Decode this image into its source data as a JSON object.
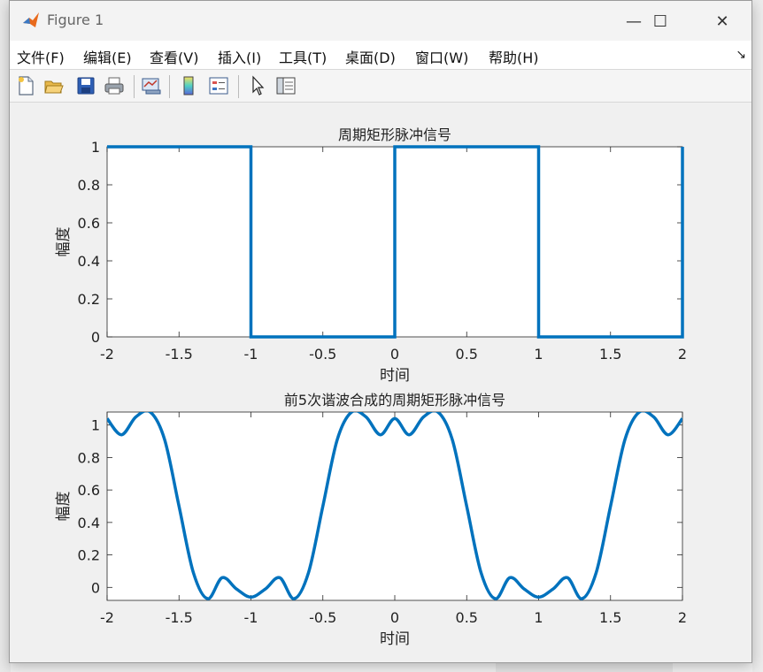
{
  "window": {
    "title": "Figure 1",
    "minimize_label": "—",
    "maximize_label": "☐",
    "close_label": "✕"
  },
  "menu": {
    "items": [
      "文件(F)",
      "编辑(E)",
      "查看(V)",
      "插入(I)",
      "工具(T)",
      "桌面(D)",
      "窗口(W)",
      "帮助(H)"
    ],
    "dock_label": "↘"
  },
  "toolbar": {
    "icons": [
      "new-figure-icon",
      "open-file-icon",
      "save-icon",
      "print-icon",
      "link-plot-icon",
      "colorbar-icon",
      "legend-icon",
      "pointer-icon",
      "property-inspector-icon"
    ]
  },
  "colors": {
    "line": "#0072bd",
    "axes_bg": "#ffffff",
    "figure_bg": "#f0f0f0"
  },
  "chart_data": [
    {
      "type": "line",
      "title": "周期矩形脉冲信号",
      "xlabel": "时间",
      "ylabel": "幅度",
      "xlim": [
        -2,
        2
      ],
      "ylim": [
        0,
        1
      ],
      "xticks": [
        "-2",
        "-1.5",
        "-1",
        "-0.5",
        "0",
        "0.5",
        "1",
        "1.5",
        "2"
      ],
      "yticks": [
        "0",
        "0.2",
        "0.4",
        "0.6",
        "0.8",
        "1"
      ],
      "series": [
        {
          "x": [
            -2,
            -1,
            -1,
            0,
            0,
            1,
            1,
            2,
            2
          ],
          "y": [
            1,
            1,
            0,
            0,
            1,
            1,
            0,
            0,
            1
          ]
        }
      ]
    },
    {
      "type": "line",
      "title": "前5次谐波合成的周期矩形脉冲信号",
      "xlabel": "时间",
      "ylabel": "幅度",
      "xlim": [
        -2,
        2
      ],
      "ylim": [
        -0.08,
        1.08
      ],
      "xticks": [
        "-2",
        "-1.5",
        "-1",
        "-0.5",
        "0",
        "0.5",
        "1",
        "1.5",
        "2"
      ],
      "yticks": [
        "0",
        "0.2",
        "0.4",
        "0.6",
        "0.8",
        "1"
      ],
      "series": [
        {
          "x": [
            -2.0,
            -1.9,
            -1.8,
            -1.7,
            -1.6,
            -1.5,
            -1.4,
            -1.3,
            -1.2,
            -1.1,
            -1.0,
            -0.9,
            -0.8,
            -0.7,
            -0.6,
            -0.5,
            -0.4,
            -0.3,
            -0.2,
            -0.1,
            0.0,
            0.1,
            0.2,
            0.3,
            0.4,
            0.5,
            0.6,
            0.7,
            0.8,
            0.9,
            1.0,
            1.1,
            1.2,
            1.3,
            1.4,
            1.5,
            1.6,
            1.7,
            1.8,
            1.9,
            2.0
          ],
          "y": [
            1.04,
            0.94,
            1.05,
            1.08,
            0.91,
            0.5,
            0.09,
            -0.07,
            0.06,
            -0.01,
            -0.06,
            -0.01,
            0.06,
            -0.07,
            0.09,
            0.5,
            0.91,
            1.08,
            1.05,
            0.94,
            1.04,
            0.94,
            1.05,
            1.08,
            0.91,
            0.5,
            0.09,
            -0.07,
            0.06,
            -0.01,
            -0.06,
            -0.01,
            0.06,
            -0.07,
            0.09,
            0.5,
            0.91,
            1.08,
            1.05,
            0.94,
            1.04
          ]
        }
      ]
    }
  ]
}
